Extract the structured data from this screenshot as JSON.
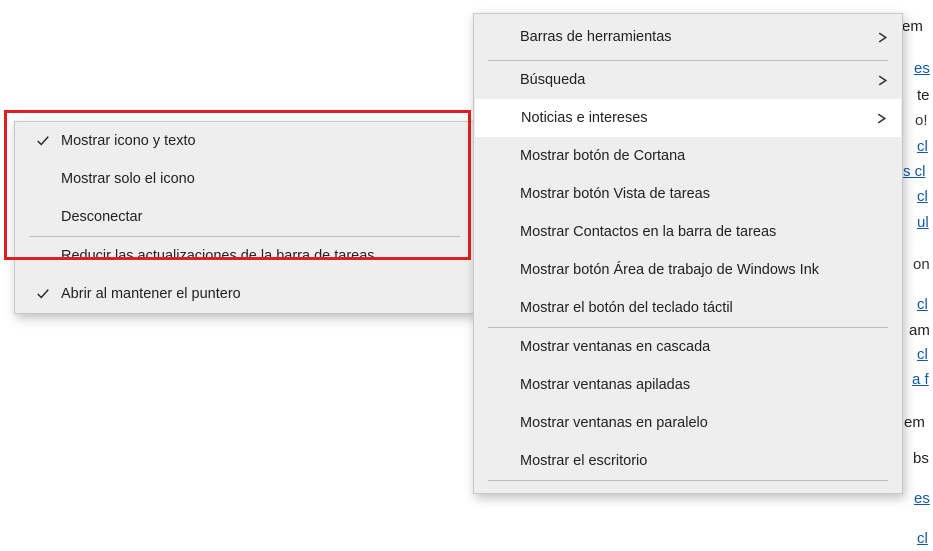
{
  "left_menu": {
    "items": [
      {
        "label": "Mostrar icono y texto",
        "checked": true,
        "has_submarker": false
      },
      {
        "label": "Mostrar solo el icono",
        "checked": false,
        "has_submarker": false
      },
      {
        "label": "Desconectar",
        "checked": false,
        "has_submarker": false
      }
    ],
    "separator_after": 2,
    "items2": [
      {
        "label": "Reducir las actualizaciones de la barra de tareas",
        "checked": false
      },
      {
        "label": "Abrir al mantener el puntero",
        "checked": true
      }
    ]
  },
  "right_menu": {
    "group1": [
      {
        "label": "Barras de herramientas",
        "submenu": true
      }
    ],
    "group2": [
      {
        "label": "Búsqueda",
        "submenu": true,
        "highlight": false
      },
      {
        "label": "Noticias e intereses",
        "submenu": true,
        "highlight": true
      },
      {
        "label": "Mostrar botón de Cortana",
        "submenu": false
      },
      {
        "label": "Mostrar botón Vista de tareas",
        "submenu": false
      },
      {
        "label": "Mostrar Contactos en la barra de tareas",
        "submenu": false
      },
      {
        "label": "Mostrar botón Área de trabajo de Windows Ink",
        "submenu": false
      },
      {
        "label": "Mostrar el botón del teclado táctil",
        "submenu": false
      }
    ],
    "group3": [
      {
        "label": "Mostrar ventanas en cascada"
      },
      {
        "label": "Mostrar ventanas apiladas"
      },
      {
        "label": "Mostrar ventanas en paralelo"
      },
      {
        "label": "Mostrar el escritorio"
      }
    ]
  },
  "bg": {
    "em": "em",
    "es1": "es",
    "te": "te",
    "o_excl": "o!",
    "cl1": "cl",
    "scl": "s cl",
    "cl2": "cl",
    "ul": "ul",
    "on": "on",
    "cl3": "cl",
    "am": "am",
    "cl4": "cl",
    "af": "a f",
    "em2": "em",
    "bs": "bs",
    "es2": "es",
    "cl5": "cl"
  }
}
